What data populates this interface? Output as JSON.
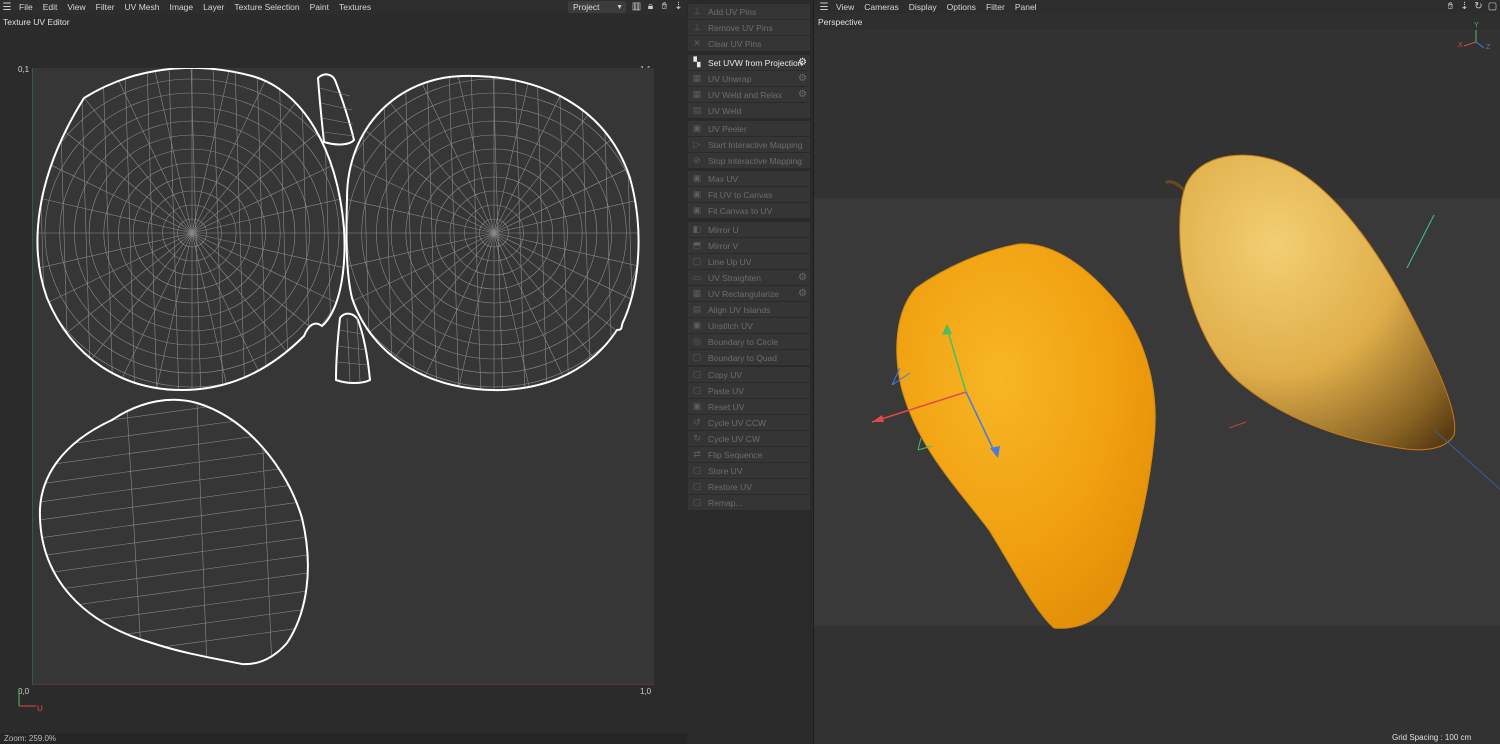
{
  "left_menu": [
    "File",
    "Edit",
    "View",
    "Filter",
    "UV Mesh",
    "Image",
    "Layer",
    "Texture Selection",
    "Paint",
    "Textures"
  ],
  "left_panel_title": "Texture UV Editor",
  "texture_dropdown": "Project",
  "corners": {
    "top_left": "0,1",
    "top_right": "1,1",
    "bottom_left": "0,0",
    "bottom_right": "1,0"
  },
  "axis_label_u": "U",
  "status_zoom": "Zoom: 259.0%",
  "commands": [
    {
      "label": "Add UV Pins",
      "icon": "pin-icon",
      "gear": false,
      "active": false
    },
    {
      "label": "Remove UV Pins",
      "icon": "pin-icon",
      "gear": false,
      "active": false
    },
    {
      "label": "Clear UV Pins",
      "icon": "close-icon",
      "gear": false,
      "active": false
    },
    {
      "label": "Set UVW from Projection",
      "icon": "projection-icon",
      "gear": true,
      "active": true
    },
    {
      "label": "UV Unwrap",
      "icon": "unwrap-icon",
      "gear": true,
      "active": false
    },
    {
      "label": "UV Weld and Relax",
      "icon": "weld-relax-icon",
      "gear": true,
      "active": false
    },
    {
      "label": "UV Weld",
      "icon": "weld-icon",
      "gear": false,
      "active": false
    },
    {
      "label": "UV Peeler",
      "icon": "peeler-icon",
      "gear": false,
      "active": false
    },
    {
      "label": "Start Interactive Mapping",
      "icon": "play-icon",
      "gear": false,
      "active": false
    },
    {
      "label": "Stop Interactive Mapping",
      "icon": "stop-icon",
      "gear": false,
      "active": false
    },
    {
      "label": "Max UV",
      "icon": "max-icon",
      "gear": false,
      "active": false
    },
    {
      "label": "Fit UV to Canvas",
      "icon": "fit-icon",
      "gear": false,
      "active": false
    },
    {
      "label": "Fit Canvas to UV",
      "icon": "fit-icon",
      "gear": false,
      "active": false
    },
    {
      "label": "Mirror U",
      "icon": "mirror-u-icon",
      "gear": false,
      "active": false
    },
    {
      "label": "Mirror V",
      "icon": "mirror-v-icon",
      "gear": false,
      "active": false
    },
    {
      "label": "Line Up UV",
      "icon": "line-up-icon",
      "gear": false,
      "active": false
    },
    {
      "label": "UV Straighten",
      "icon": "straighten-icon",
      "gear": true,
      "active": false
    },
    {
      "label": "UV Rectangularize",
      "icon": "rectangularize-icon",
      "gear": true,
      "active": false
    },
    {
      "label": "Align UV Islands",
      "icon": "align-icon",
      "gear": false,
      "active": false
    },
    {
      "label": "Unstitch UV",
      "icon": "unstitch-icon",
      "gear": false,
      "active": false
    },
    {
      "label": "Boundary to Circle",
      "icon": "circle-icon",
      "gear": false,
      "active": false
    },
    {
      "label": "Boundary to Quad",
      "icon": "quad-icon",
      "gear": false,
      "active": false
    },
    {
      "label": "Copy UV",
      "icon": "copy-icon",
      "gear": false,
      "active": false
    },
    {
      "label": "Paste UV",
      "icon": "paste-icon",
      "gear": false,
      "active": false
    },
    {
      "label": "Reset UV",
      "icon": "reset-icon",
      "gear": false,
      "active": false
    },
    {
      "label": "Cycle UV CCW",
      "icon": "cycle-ccw-icon",
      "gear": false,
      "active": false
    },
    {
      "label": "Cycle UV CW",
      "icon": "cycle-cw-icon",
      "gear": false,
      "active": false
    },
    {
      "label": "Flip Sequence",
      "icon": "flip-icon",
      "gear": false,
      "active": false
    },
    {
      "label": "Store UV",
      "icon": "store-icon",
      "gear": false,
      "active": false
    },
    {
      "label": "Restore UV",
      "icon": "restore-icon",
      "gear": false,
      "active": false
    },
    {
      "label": "Remap...",
      "icon": "remap-icon",
      "gear": false,
      "active": false
    }
  ],
  "right_menu": [
    "View",
    "Cameras",
    "Display",
    "Options",
    "Filter",
    "Panel"
  ],
  "viewport_title": "Perspective",
  "grid_spacing": "Grid Spacing : 100 cm",
  "axis_labels": {
    "x": "X",
    "y": "Y",
    "z": "Z"
  },
  "colors": {
    "mango_slice": "#f2a012",
    "mango_whole": "#e2b24a",
    "axis_x": "#e24a4a",
    "axis_y": "#48c060",
    "axis_z": "#4a7ae0",
    "uv_outline": "#ffffff"
  }
}
